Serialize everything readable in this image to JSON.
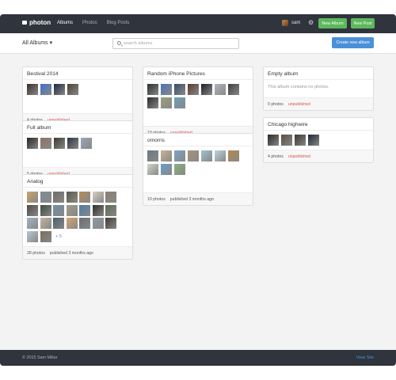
{
  "app": {
    "brand": "photon"
  },
  "nav": [
    {
      "label": "Albums",
      "active": true
    },
    {
      "label": "Photos"
    },
    {
      "label": "Blog Posts"
    }
  ],
  "user": {
    "name": "sam"
  },
  "header_buttons": {
    "new_album": "New Album",
    "new_post": "New Post"
  },
  "toolbar": {
    "all_albums": "All Albums ▾",
    "search_placeholder": "search albums",
    "create": "Create new album"
  },
  "albums": {
    "bestival": {
      "title": "Bestival 2014",
      "count": "4 photos",
      "status": "unpublished",
      "thumbs": [
        "#3a2f2a",
        "#3f6fd0",
        "#1f2a3a",
        "#4a4138"
      ]
    },
    "full": {
      "title": "Full album",
      "count": "5 photos",
      "status": "unpublished",
      "thumbs": [
        "#2a2220",
        "#8e7460",
        "#3a3a32",
        "#2b3340",
        "#9aa6b8"
      ]
    },
    "analog": {
      "title": "Analog",
      "count": "28 photos",
      "status": "published 3 months ago",
      "more": "+ 5",
      "thumbs": [
        "#c9a66b",
        "#7e8c92",
        "#6f6b65",
        "#5b5a4a",
        "#b48a5a",
        "#d8cfc1",
        "#8b7f72",
        "#4e4c44",
        "#3e4a3a",
        "#6c8fa3",
        "#a09a88",
        "#4d7ea3",
        "#2f2d2b",
        "#5d6b4f",
        "#9fb6c4",
        "#c4b49c",
        "#4a5f6d",
        "#d9a36c",
        "#6a6f72",
        "#8a9aa7",
        "#3d3b36",
        "#b7c9d3",
        "#7a6d5a"
      ]
    },
    "iphone": {
      "title": "Random iPhone Pictures",
      "count": "10 photos",
      "status": "unpublished",
      "thumbs": [
        "#2a2f2e",
        "#4b73b8",
        "#3a4e6a",
        "#5a3a2a",
        "#1f1e24",
        "#b0b6bd",
        "#3c3f3a",
        "#2c2a28",
        "#9aa07a",
        "#6aa0b8"
      ]
    },
    "omorris": {
      "title": "omorris",
      "count": "10 photos",
      "status": "published 3 months ago",
      "thumbs": [
        "#6d7880",
        "#c9b391",
        "#7fa4c8",
        "#a8937a",
        "#9cc2cf",
        "#bfd3e0",
        "#b48a4a",
        "#cfd6c8",
        "#6b9ec9",
        "#8ab37a"
      ]
    },
    "empty": {
      "title": "Empty album",
      "message": "This album contains no photos.",
      "count": "0 photos",
      "status": "unpublished"
    },
    "chicago": {
      "title": "Chicago highwire",
      "count": "4 photos",
      "status": "unpublished",
      "thumbs": [
        "#2a2623",
        "#5a4a3c",
        "#3a3532",
        "#1e2633"
      ]
    }
  },
  "footer": {
    "copyright": "© 2015 Sam Millar",
    "view_site": "View Site"
  }
}
